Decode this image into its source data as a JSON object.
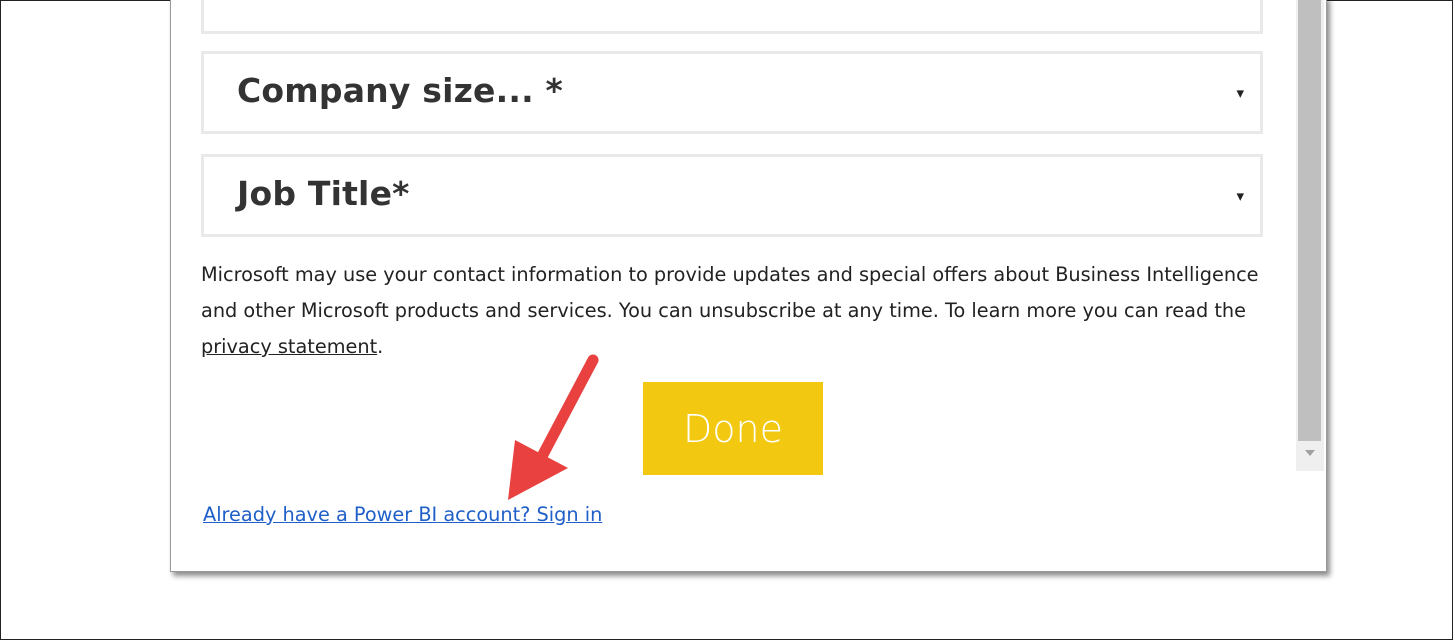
{
  "form": {
    "company_size": {
      "label": "Company size... *",
      "caret": "▾"
    },
    "job_title": {
      "label": "Job Title*",
      "caret": "▾"
    },
    "notice": {
      "text_before_link": "Microsoft may use your contact information to provide updates and special offers about Business Intelligence and other Microsoft products and services. You can unsubscribe at any time. To learn more you can read the ",
      "link_label": "privacy statement",
      "text_after_link": "."
    },
    "done_label": "Done",
    "signin_link": "Already have a Power BI account? Sign in"
  },
  "colors": {
    "done_button": "#f2c811",
    "link": "#1f5fc8",
    "annotation_arrow": "#e8413f"
  },
  "annotation": {
    "icon": "arrow-icon"
  }
}
